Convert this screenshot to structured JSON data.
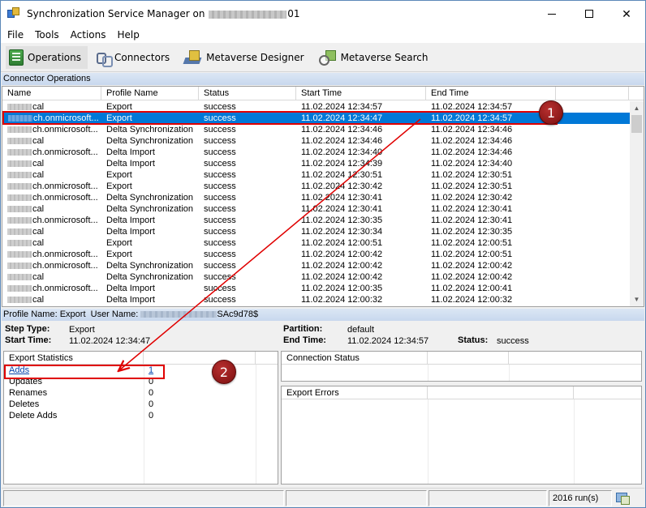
{
  "window": {
    "title_prefix": "Synchronization Service Manager on ",
    "title_suffix": "01",
    "btn_minimize": "minimize",
    "btn_maximize": "maximize",
    "btn_close": "✕"
  },
  "menu": [
    "File",
    "Tools",
    "Actions",
    "Help"
  ],
  "toolbar": {
    "operations": "Operations",
    "connectors": "Connectors",
    "metaverse_designer": "Metaverse Designer",
    "metaverse_search": "Metaverse Search"
  },
  "section_title": "Connector Operations",
  "ops_columns": [
    "Name",
    "Profile Name",
    "Status",
    "Start Time",
    "End Time"
  ],
  "ops_rows": [
    {
      "name": "cal",
      "profile": "Export",
      "status": "success",
      "start": "11.02.2024 12:34:57",
      "end": "11.02.2024 12:34:57"
    },
    {
      "name": "ch.onmicrosoft...",
      "profile": "Export",
      "status": "success",
      "start": "11.02.2024 12:34:47",
      "end": "11.02.2024 12:34:57"
    },
    {
      "name": "ch.onmicrosoft...",
      "profile": "Delta Synchronization",
      "status": "success",
      "start": "11.02.2024 12:34:46",
      "end": "11.02.2024 12:34:46"
    },
    {
      "name": "cal",
      "profile": "Delta Synchronization",
      "status": "success",
      "start": "11.02.2024 12:34:46",
      "end": "11.02.2024 12:34:46"
    },
    {
      "name": "ch.onmicrosoft...",
      "profile": "Delta Import",
      "status": "success",
      "start": "11.02.2024 12:34:40",
      "end": "11.02.2024 12:34:46"
    },
    {
      "name": "cal",
      "profile": "Delta Import",
      "status": "success",
      "start": "11.02.2024 12:34:39",
      "end": "11.02.2024 12:34:40"
    },
    {
      "name": "cal",
      "profile": "Export",
      "status": "success",
      "start": "11.02.2024 12:30:51",
      "end": "11.02.2024 12:30:51"
    },
    {
      "name": "ch.onmicrosoft...",
      "profile": "Export",
      "status": "success",
      "start": "11.02.2024 12:30:42",
      "end": "11.02.2024 12:30:51"
    },
    {
      "name": "ch.onmicrosoft...",
      "profile": "Delta Synchronization",
      "status": "success",
      "start": "11.02.2024 12:30:41",
      "end": "11.02.2024 12:30:42"
    },
    {
      "name": "cal",
      "profile": "Delta Synchronization",
      "status": "success",
      "start": "11.02.2024 12:30:41",
      "end": "11.02.2024 12:30:41"
    },
    {
      "name": "ch.onmicrosoft...",
      "profile": "Delta Import",
      "status": "success",
      "start": "11.02.2024 12:30:35",
      "end": "11.02.2024 12:30:41"
    },
    {
      "name": "cal",
      "profile": "Delta Import",
      "status": "success",
      "start": "11.02.2024 12:30:34",
      "end": "11.02.2024 12:30:35"
    },
    {
      "name": "cal",
      "profile": "Export",
      "status": "success",
      "start": "11.02.2024 12:00:51",
      "end": "11.02.2024 12:00:51"
    },
    {
      "name": "ch.onmicrosoft...",
      "profile": "Export",
      "status": "success",
      "start": "11.02.2024 12:00:42",
      "end": "11.02.2024 12:00:51"
    },
    {
      "name": "ch.onmicrosoft...",
      "profile": "Delta Synchronization",
      "status": "success",
      "start": "11.02.2024 12:00:42",
      "end": "11.02.2024 12:00:42"
    },
    {
      "name": "cal",
      "profile": "Delta Synchronization",
      "status": "success",
      "start": "11.02.2024 12:00:42",
      "end": "11.02.2024 12:00:42"
    },
    {
      "name": "ch.onmicrosoft...",
      "profile": "Delta Import",
      "status": "success",
      "start": "11.02.2024 12:00:35",
      "end": "11.02.2024 12:00:41"
    },
    {
      "name": "cal",
      "profile": "Delta Import",
      "status": "success",
      "start": "11.02.2024 12:00:32",
      "end": "11.02.2024 12:00:32"
    }
  ],
  "selected_row_index": 1,
  "profile_line": {
    "profile_label": "Profile Name:",
    "profile_value": "Export",
    "user_label": "User Name:",
    "user_value": "SAc9d78$"
  },
  "details": {
    "step_type_label": "Step Type:",
    "step_type_value": "Export",
    "start_time_label": "Start Time:",
    "start_time_value": "11.02.2024 12:34:47",
    "partition_label": "Partition:",
    "partition_value": "default",
    "end_time_label": "End Time:",
    "end_time_value": "11.02.2024 12:34:57",
    "status_label": "Status:",
    "status_value": "success"
  },
  "export_stats": {
    "header": "Export Statistics",
    "rows": [
      {
        "name": "Adds",
        "value": "1",
        "link": true
      },
      {
        "name": "Updates",
        "value": "0",
        "link": false
      },
      {
        "name": "Renames",
        "value": "0",
        "link": false
      },
      {
        "name": "Deletes",
        "value": "0",
        "link": false
      },
      {
        "name": "Delete Adds",
        "value": "0",
        "link": false
      }
    ]
  },
  "connection_status_header": "Connection Status",
  "export_errors_header": "Export Errors",
  "statusbar": {
    "runs": "2016 run(s)"
  },
  "annotations": {
    "marker1": "1",
    "marker2": "2",
    "color": "#e00000"
  }
}
